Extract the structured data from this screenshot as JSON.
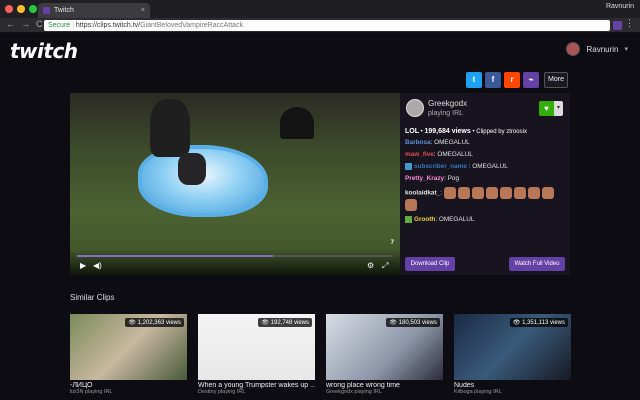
{
  "browser": {
    "tab_title": "Twitch",
    "tab_close": "×",
    "profile": "Ravnurin",
    "secure_label": "Secure",
    "url_host": "https://clips.twitch.tv/",
    "url_path": "GiantBelovedVampireRaccAttack",
    "nav_back": "←",
    "nav_forward": "→",
    "nav_reload": "C",
    "menu_icon": "⋮"
  },
  "header": {
    "logo": "twitch",
    "username": "Ravnurin",
    "chevron": "▾"
  },
  "share": {
    "twitter": "t",
    "facebook": "f",
    "reddit": "r",
    "link": "⌁",
    "more_label": "More",
    "colors": {
      "twitter": "#1da1f2",
      "facebook": "#3b5998",
      "reddit": "#ff4500",
      "link": "#6441a4"
    }
  },
  "player": {
    "time": "7",
    "progress": 0.62,
    "play_icon": "▶",
    "volume_icon": "◀)",
    "settings_icon": "⚙",
    "fullscreen_icon": "⤢"
  },
  "broadcaster": {
    "name": "Greekgodx",
    "sub": "playing IRL",
    "heart": "♥",
    "dropdown": "▾"
  },
  "meta": {
    "game": "LOL",
    "views": "199,684 views",
    "clipped_prefix": "Clipped by",
    "clipper": "ztroosix"
  },
  "chat": [
    {
      "user": "Barbosa",
      "color": "#5c8fd6",
      "text": "OMEGALUL",
      "badge": false
    },
    {
      "user": "maw_five",
      "color": "#e24b4b",
      "text": "OMEGALUL",
      "badge": false
    },
    {
      "user": "subscriber_name",
      "color": "#2e78c2",
      "text": "OMEGALUL",
      "badge": true
    },
    {
      "user": "Pretty_Krazy",
      "color": "#ff8ad8",
      "text": "Pog",
      "badge": false
    },
    {
      "user": "koolaidkat_",
      "color": "#e0e0e0",
      "text": "",
      "badge": false
    },
    {
      "user": "Grooth",
      "color": "#f4d03f",
      "text": "OMEGALUL",
      "badge": true
    }
  ],
  "actions": {
    "download": "Download Clip",
    "watch_full": "Watch Full Video"
  },
  "similar": {
    "title": "Similar Clips",
    "clips": [
      {
        "views": "1,202,363 views",
        "title": "-ЛИЦО",
        "channel": "lizi3N playing IRL"
      },
      {
        "views": "192,748 views",
        "title": "When a young Trumpster wakes up ...",
        "channel": "Destiny playing IRL"
      },
      {
        "views": "180,503 views",
        "title": "wrong place wrong time",
        "channel": "Greekgodx playing IRL"
      },
      {
        "views": "1,351,113 views",
        "title": "Nudes",
        "channel": "Kitboga playing IRL"
      }
    ]
  }
}
